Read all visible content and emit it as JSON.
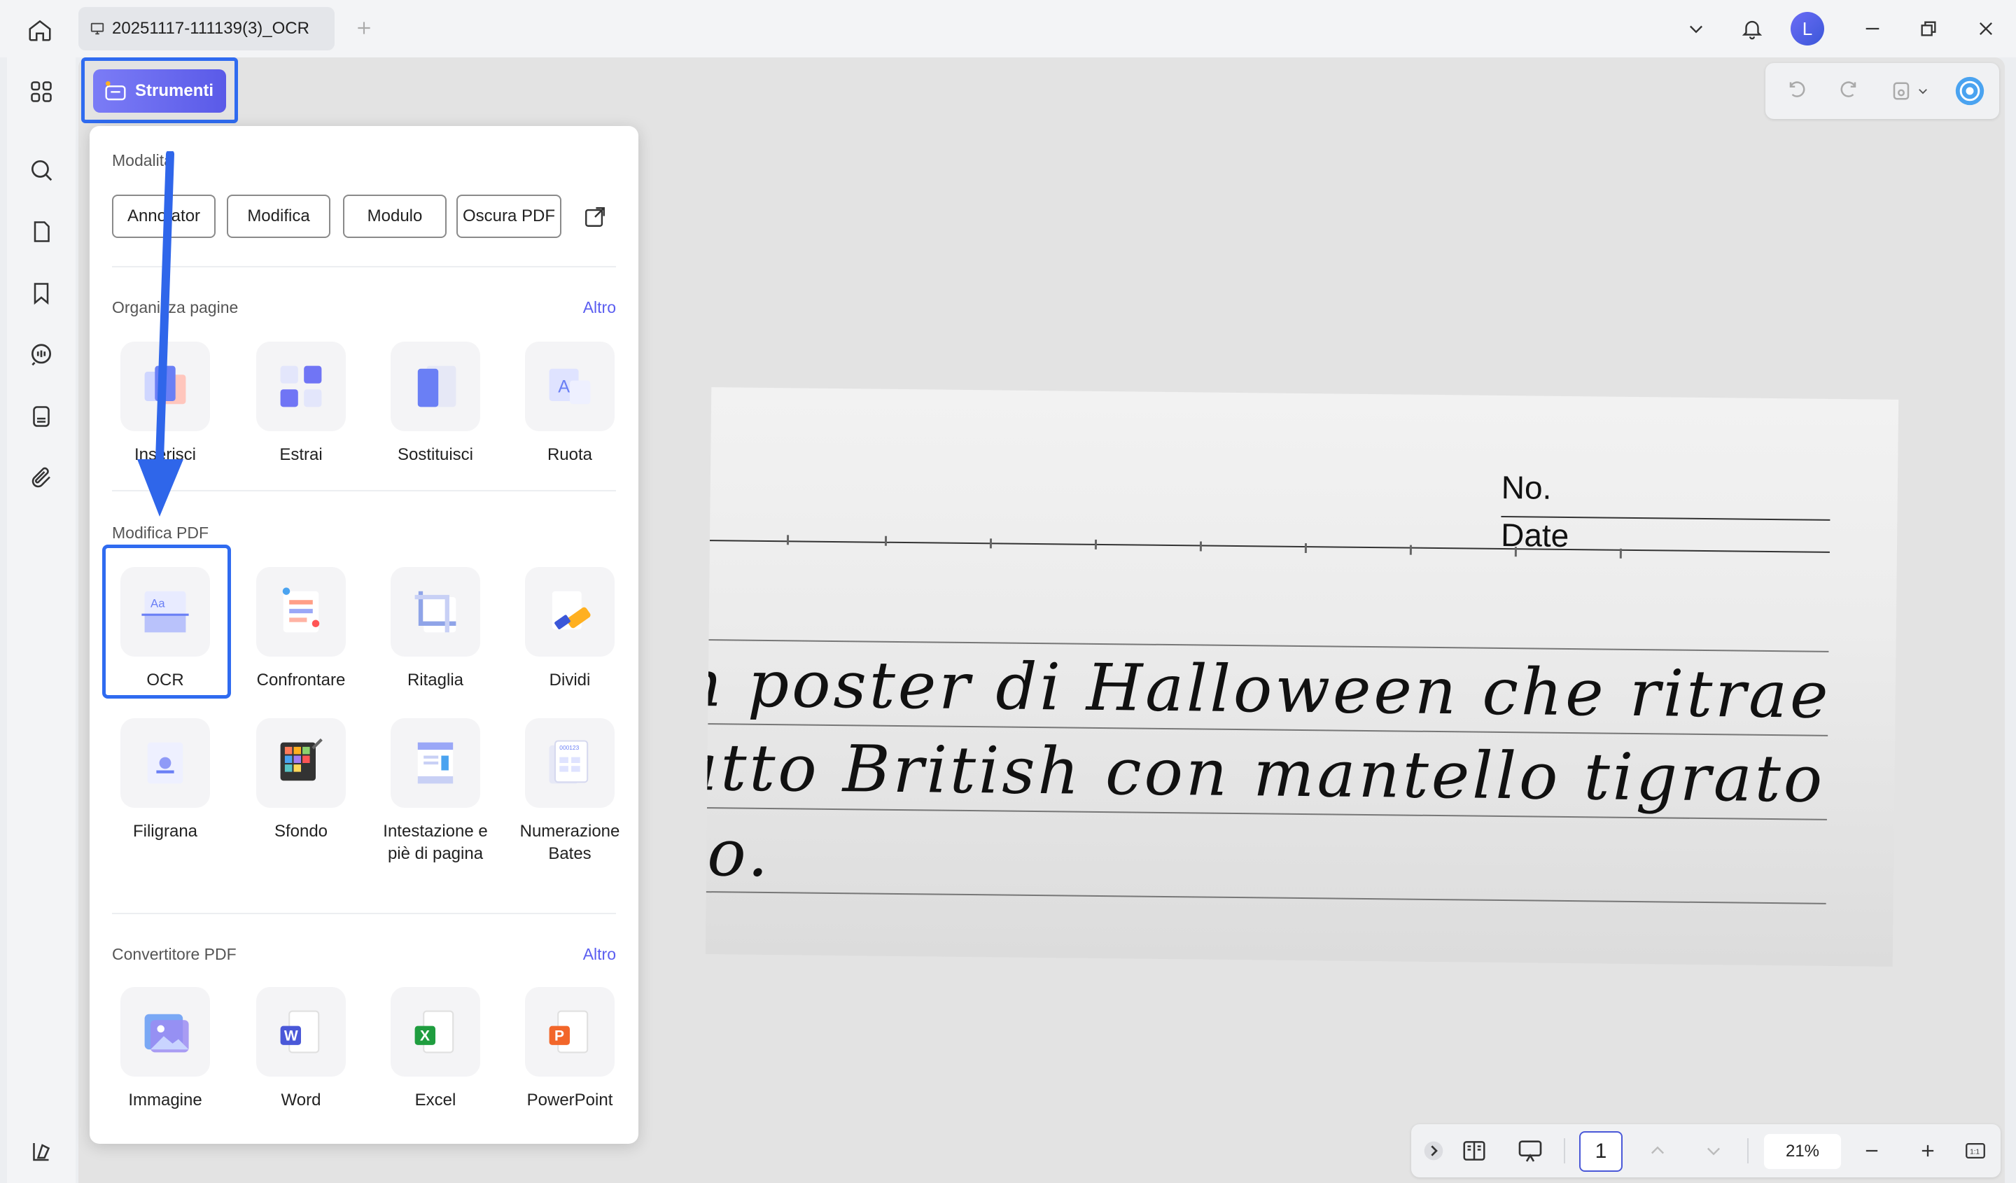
{
  "window": {
    "tab_title": "20251117-111139(3)_OCR",
    "avatar_initial": "L"
  },
  "strumenti": {
    "label": "Strumenti"
  },
  "panel": {
    "modes": {
      "title": "Modalità",
      "buttons": [
        "Annotator",
        "Modifica",
        "Modulo",
        "Oscura PDF"
      ]
    },
    "organize": {
      "title": "Organizza pagine",
      "more": "Altro",
      "tools": [
        "Inserisci",
        "Estrai",
        "Sostituisci",
        "Ruota"
      ]
    },
    "edit": {
      "title": "Modifica PDF",
      "tools": [
        "OCR",
        "Confrontare",
        "Ritaglia",
        "Dividi",
        "Filigrana",
        "Sfondo",
        "Intestazione e piè di pagina",
        "Numerazione Bates"
      ]
    },
    "convert": {
      "title": "Convertitore PDF",
      "more": "Altro",
      "tools": [
        "Immagine",
        "Word",
        "Excel",
        "PowerPoint"
      ]
    }
  },
  "document": {
    "no_label": "No.",
    "date_label": "Date",
    "handwriting": [
      "n poster di Halloween che ritrae",
      "atto British con mantello tigrato",
      "to."
    ]
  },
  "bottom_bar": {
    "page": "1",
    "zoom": "21%"
  },
  "colors": {
    "accent": "#5b5ef0",
    "highlight": "#2f6bf0",
    "arrow": "#2f66ea"
  }
}
